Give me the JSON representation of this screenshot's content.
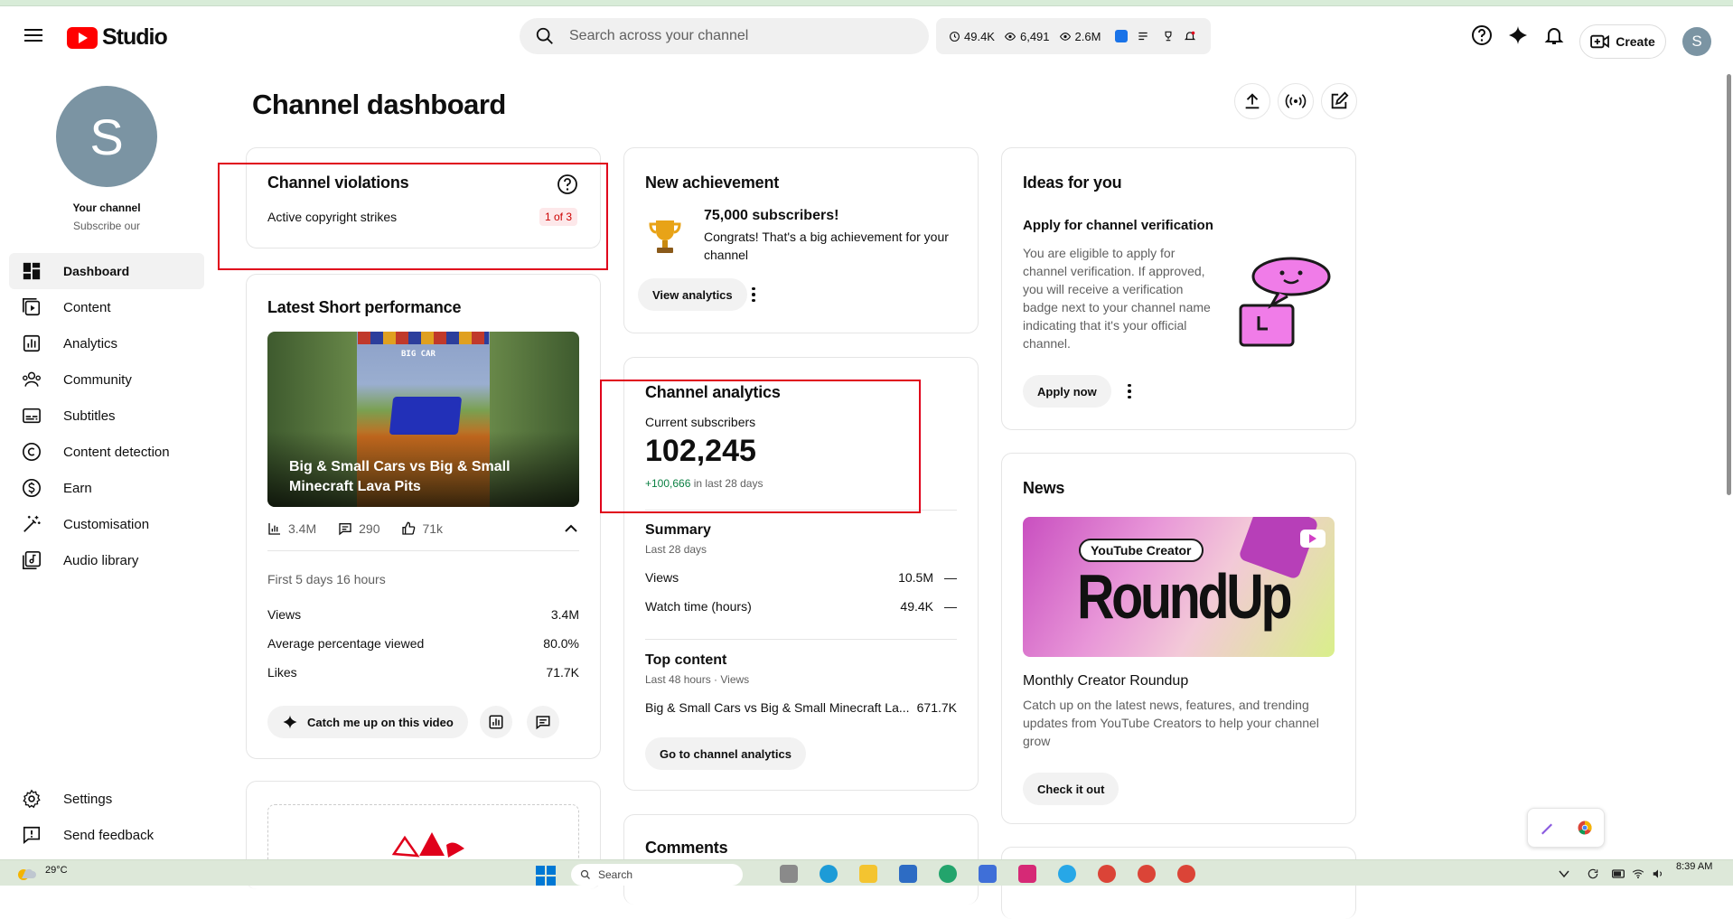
{
  "header": {
    "app_name": "Studio",
    "search_placeholder": "Search across your channel",
    "stats": [
      "49.4K",
      "6,491",
      "2.6M"
    ],
    "create_label": "Create",
    "avatar_letter": "S"
  },
  "sidebar": {
    "avatar_letter": "S",
    "channel_name": "Your channel",
    "channel_sub": "Subscribe our",
    "items": [
      {
        "label": "Dashboard",
        "icon": "dashboard-icon"
      },
      {
        "label": "Content",
        "icon": "content-icon"
      },
      {
        "label": "Analytics",
        "icon": "analytics-icon"
      },
      {
        "label": "Community",
        "icon": "community-icon"
      },
      {
        "label": "Subtitles",
        "icon": "subtitles-icon"
      },
      {
        "label": "Content detection",
        "icon": "copyright-icon"
      },
      {
        "label": "Earn",
        "icon": "dollar-icon"
      },
      {
        "label": "Customisation",
        "icon": "magic-wand-icon"
      },
      {
        "label": "Audio library",
        "icon": "audio-library-icon"
      }
    ],
    "bottom_items": [
      {
        "label": "Settings",
        "icon": "gear-icon"
      },
      {
        "label": "Send feedback",
        "icon": "feedback-icon"
      }
    ]
  },
  "main": {
    "title": "Channel dashboard"
  },
  "violations": {
    "title": "Channel violations",
    "label": "Active copyright strikes",
    "badge": "1 of 3"
  },
  "short": {
    "title": "Latest Short performance",
    "thumb_caption": "Big & Small Cars vs Big & Small Minecraft Lava Pits",
    "thumb_sign": "BIG CAR",
    "views": "3.4M",
    "comments": "290",
    "likes": "71k",
    "period": "First 5 days 16 hours",
    "rows": [
      {
        "label": "Views",
        "value": "3.4M"
      },
      {
        "label": "Average percentage viewed",
        "value": "80.0%"
      },
      {
        "label": "Likes",
        "value": "71.7K"
      }
    ],
    "catch_up_label": "Catch me up on this video"
  },
  "achievement": {
    "title": "New achievement",
    "headline": "75,000 subscribers!",
    "body": "Congrats! That's a big achievement for your channel",
    "button": "View analytics"
  },
  "analytics": {
    "title": "Channel analytics",
    "subs_label": "Current subscribers",
    "subs_value": "102,245",
    "subs_delta": "+100,666",
    "subs_delta_period": "in last 28 days",
    "summary_title": "Summary",
    "summary_period": "Last 28 days",
    "summary_rows": [
      {
        "label": "Views",
        "value": "10.5M",
        "trend": "—"
      },
      {
        "label": "Watch time (hours)",
        "value": "49.4K",
        "trend": "—"
      }
    ],
    "top_title": "Top content",
    "top_period": "Last 48 hours · Views",
    "top_item": "Big & Small Cars vs Big & Small Minecraft La...",
    "top_value": "671.7K",
    "button": "Go to channel analytics"
  },
  "comments": {
    "title": "Comments"
  },
  "ideas": {
    "title": "Ideas for you",
    "heading": "Apply for channel verification",
    "body": "You are eligible to apply for channel verification. If approved, you will receive a verification badge next to your channel name indicating that it's your official channel.",
    "button": "Apply now"
  },
  "news": {
    "title": "News",
    "banner_tag": "YouTube Creator",
    "banner_text": "RoundUp",
    "heading": "Monthly Creator Roundup",
    "body": "Catch up on the latest news, features, and trending updates from YouTube Creators to help your channel grow",
    "button": "Check it out"
  },
  "taskbar": {
    "temperature": "29°C",
    "search_label": "Search",
    "time": "8:39 AM"
  },
  "colors": {
    "accent_red": "#ff0000",
    "annotation_red": "#e0001b",
    "positive_green": "#0b8043",
    "avatar": "#7b94a3"
  }
}
